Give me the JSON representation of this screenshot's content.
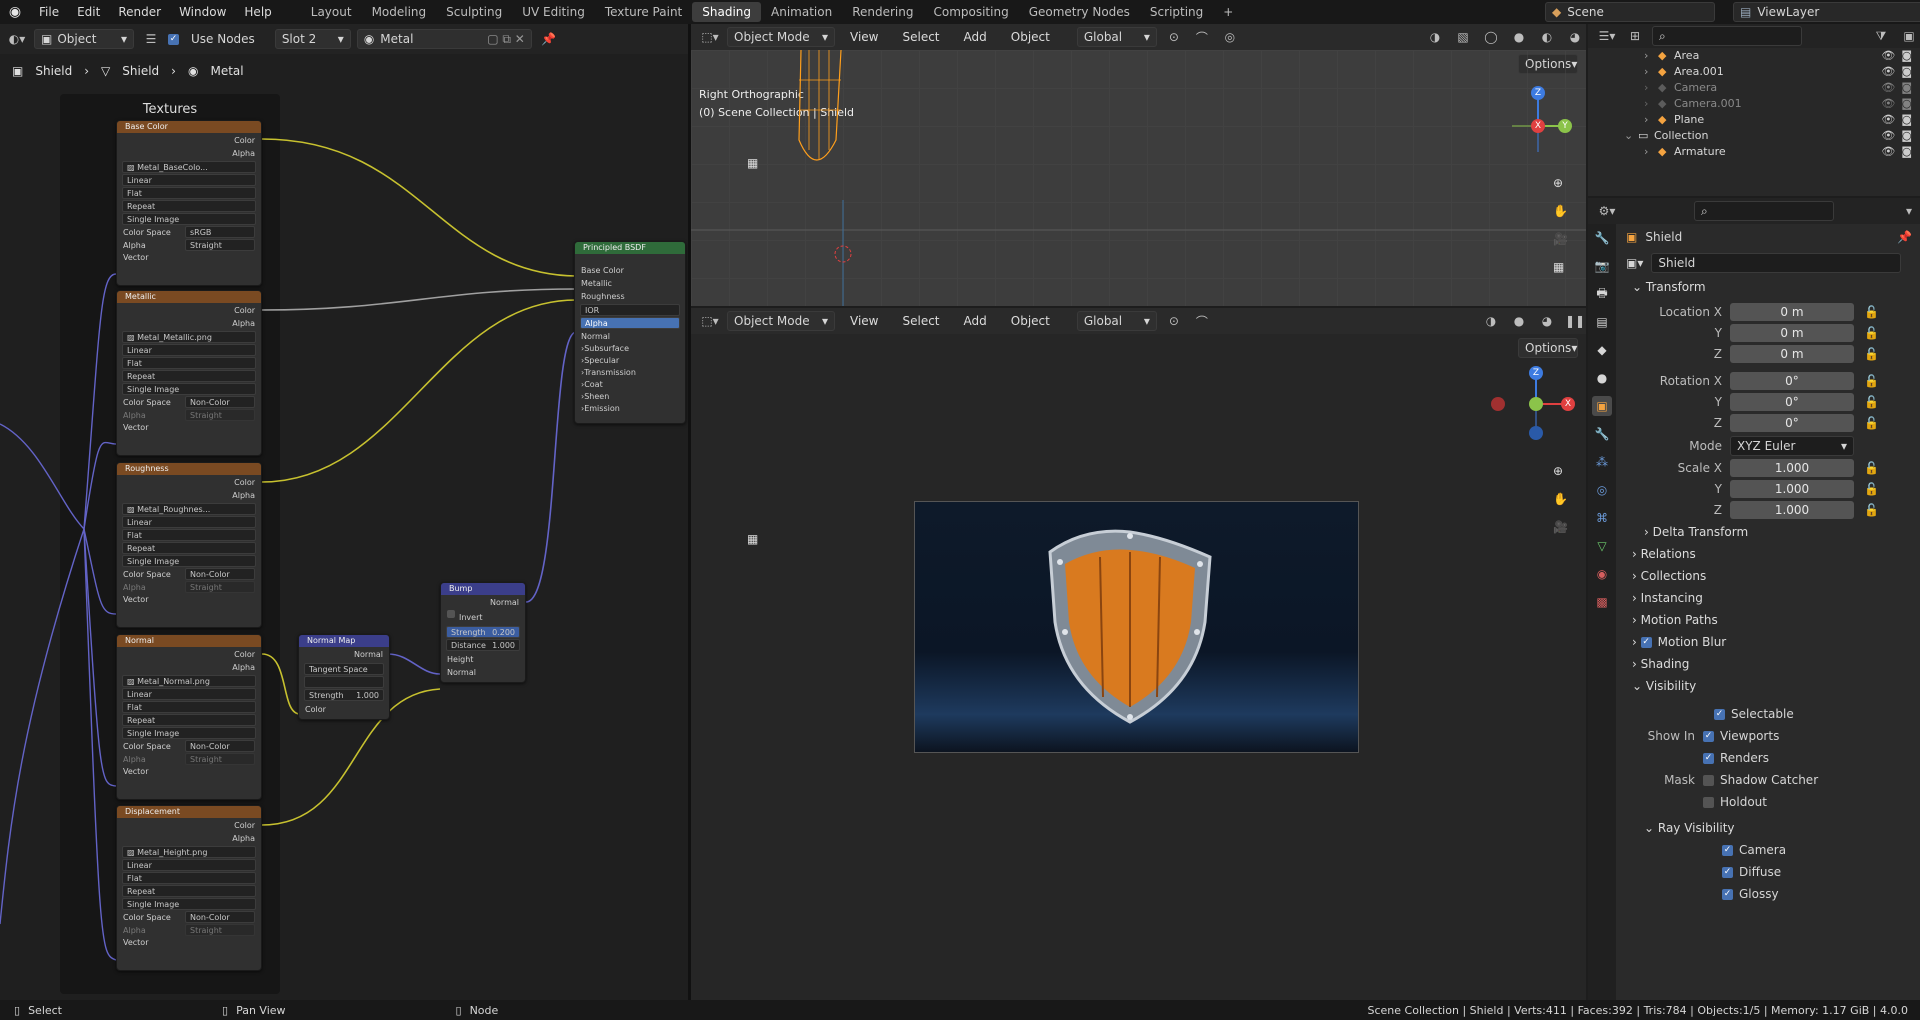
{
  "topmenu": {
    "items": [
      "File",
      "Edit",
      "Render",
      "Window",
      "Help"
    ],
    "workspaces": [
      "Layout",
      "Modeling",
      "Sculpting",
      "UV Editing",
      "Texture Paint",
      "Shading",
      "Animation",
      "Rendering",
      "Compositing",
      "Geometry Nodes",
      "Scripting"
    ],
    "active_workspace": "Shading",
    "scene": "Scene",
    "view_layer": "ViewLayer"
  },
  "node_header": {
    "mode": "Object",
    "use_nodes": "Use Nodes",
    "slot": "Slot 2",
    "material": "Metal"
  },
  "breadcrumb": [
    "Shield",
    "Shield",
    "Metal"
  ],
  "frame_label": "Textures",
  "image_nodes": [
    {
      "title": "Base Color",
      "file": "Metal_BaseColo...",
      "colorspace": "sRGB",
      "alpha": "Straight"
    },
    {
      "title": "Metallic",
      "file": "Metal_Metallic.png",
      "colorspace": "Non-Color",
      "alpha": "Straight"
    },
    {
      "title": "Roughness",
      "file": "Metal_Roughnes...",
      "colorspace": "Non-Color",
      "alpha": "Straight"
    },
    {
      "title": "Normal",
      "file": "Metal_Normal.png",
      "colorspace": "Non-Color",
      "alpha": "Straight"
    },
    {
      "title": "Displacement",
      "file": "Metal_Height.png",
      "colorspace": "Non-Color",
      "alpha": "Straight"
    }
  ],
  "image_node_labels": {
    "color": "Color",
    "alpha": "Alpha",
    "linear": "Linear",
    "flat": "Flat",
    "repeat": "Repeat",
    "single": "Single Image",
    "colorspace": "Color Space",
    "alpha_mode": "Alpha",
    "vector": "Vector"
  },
  "bsdf": {
    "title": "Principled BSDF",
    "inputs": [
      "Base Color",
      "Metallic",
      "Roughness",
      "IOR",
      "Alpha",
      "Normal"
    ],
    "panels": [
      "Subsurface",
      "Specular",
      "Transmission",
      "Coat",
      "Sheen",
      "Emission"
    ]
  },
  "normal_map": {
    "title": "Normal Map",
    "out": "Normal",
    "space": "Tangent Space",
    "strength_label": "Strength",
    "strength": "1.000",
    "color": "Color"
  },
  "bump": {
    "title": "Bump",
    "out": "Normal",
    "invert": "Invert",
    "strength_label": "Strength",
    "strength": "0.200",
    "distance_label": "Distance",
    "distance": "1.000",
    "height": "Height",
    "normal": "Normal"
  },
  "viewport_top": {
    "mode": "Object Mode",
    "view": "View",
    "select": "Select",
    "add": "Add",
    "object": "Object",
    "orientation": "Global",
    "options": "Options",
    "view_name": "Right Orthographic",
    "collection": "(0) Scene Collection | Shield"
  },
  "viewport_bottom": {
    "mode": "Object Mode",
    "view": "View",
    "select": "Select",
    "add": "Add",
    "object": "Object",
    "orientation": "Global",
    "options": "Options"
  },
  "gizmo": {
    "x": "X",
    "y": "Y",
    "z": "Z"
  },
  "outliner": {
    "rows": [
      {
        "name": "Area",
        "indent": 1
      },
      {
        "name": "Area.001",
        "indent": 1
      },
      {
        "name": "Camera",
        "indent": 1
      },
      {
        "name": "Camera.001",
        "indent": 1
      },
      {
        "name": "Plane",
        "indent": 1
      },
      {
        "name": "Collection",
        "indent": 0
      },
      {
        "name": "Armature",
        "indent": 1
      }
    ]
  },
  "properties": {
    "object_name": "Shield",
    "data_name": "Shield",
    "transform": "Transform",
    "location_label": "Location X",
    "loc": [
      "0 m",
      "0 m",
      "0 m"
    ],
    "rotation_label": "Rotation X",
    "rot": [
      "0°",
      "0°",
      "0°"
    ],
    "mode_label": "Mode",
    "mode": "XYZ Euler",
    "scale_label": "Scale X",
    "scale": [
      "1.000",
      "1.000",
      "1.000"
    ],
    "y": "Y",
    "z": "Z",
    "sections": [
      "Delta Transform",
      "Relations",
      "Collections",
      "Instancing",
      "Motion Paths",
      "Motion Blur",
      "Shading",
      "Visibility"
    ],
    "selectable": "Selectable",
    "show_in": "Show In",
    "viewports": "Viewports",
    "renders": "Renders",
    "mask": "Mask",
    "shadow_catcher": "Shadow Catcher",
    "holdout": "Holdout",
    "ray_visibility": "Ray Visibility",
    "camera": "Camera",
    "diffuse": "Diffuse",
    "glossy": "Glossy"
  },
  "status": {
    "select": "Select",
    "pan": "Pan View",
    "node": "Node",
    "info": "Scene Collection | Shield | Verts:411 | Faces:392 | Tris:784 | Objects:1/5 | Memory: 1.17 GiB | 4.0.0"
  },
  "colors": {
    "accent": "#4772b3",
    "header_orange": "#7a4a22",
    "bsdf_green": "#2f6b3a",
    "vector_blue": "#3b3e8a",
    "link_yellow": "#c7c12f",
    "link_purple": "#6363c7",
    "link_grey": "#a0a0a0"
  }
}
